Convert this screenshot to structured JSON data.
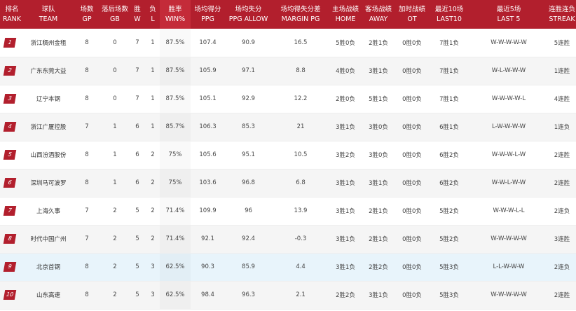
{
  "headers": [
    {
      "cn": "排名",
      "en": "RANK"
    },
    {
      "cn": "球队",
      "en": "TEAM"
    },
    {
      "cn": "场数",
      "en": "GP"
    },
    {
      "cn": "落后场数",
      "en": "GB"
    },
    {
      "cn": "胜",
      "en": "W"
    },
    {
      "cn": "负",
      "en": "L"
    },
    {
      "cn": "胜率",
      "en": "WIN%"
    },
    {
      "cn": "场均得分",
      "en": "PPG"
    },
    {
      "cn": "场均失分",
      "en": "PPG ALLOW"
    },
    {
      "cn": "场均得失分差",
      "en": "MARGIN PG"
    },
    {
      "cn": "主场战绩",
      "en": "HOME"
    },
    {
      "cn": "客场战绩",
      "en": "AWAY"
    },
    {
      "cn": "加时战绩",
      "en": "OT"
    },
    {
      "cn": "最近10场",
      "en": "LAST10"
    },
    {
      "cn": "最近5场",
      "en": "LAST 5"
    },
    {
      "cn": "连胜连负",
      "en": "STREAK"
    }
  ],
  "rows": [
    {
      "rank": "1",
      "team": "浙江稠州金租",
      "gp": "8",
      "gb": "0",
      "w": "7",
      "l": "1",
      "win_pct": "87.5%",
      "ppg": "107.4",
      "ppg_allow": "90.9",
      "margin": "16.5",
      "home": "5胜0负",
      "away": "2胜1负",
      "ot": "0胜0负",
      "last10": "7胜1负",
      "last5": "W-W-W-W-W",
      "streak": "5连胜"
    },
    {
      "rank": "2",
      "team": "广东东莞大益",
      "gp": "8",
      "gb": "0",
      "w": "7",
      "l": "1",
      "win_pct": "87.5%",
      "ppg": "105.9",
      "ppg_allow": "97.1",
      "margin": "8.8",
      "home": "4胜0负",
      "away": "3胜1负",
      "ot": "0胜0负",
      "last10": "7胜1负",
      "last5": "W-L-W-W-W",
      "streak": "1连胜"
    },
    {
      "rank": "3",
      "team": "辽宁本钢",
      "gp": "8",
      "gb": "0",
      "w": "7",
      "l": "1",
      "win_pct": "87.5%",
      "ppg": "105.1",
      "ppg_allow": "92.9",
      "margin": "12.2",
      "home": "2胜0负",
      "away": "5胜1负",
      "ot": "0胜0负",
      "last10": "7胜1负",
      "last5": "W-W-W-W-L",
      "streak": "4连胜"
    },
    {
      "rank": "4",
      "team": "浙江广厦控股",
      "gp": "7",
      "gb": "1",
      "w": "6",
      "l": "1",
      "win_pct": "85.7%",
      "ppg": "106.3",
      "ppg_allow": "85.3",
      "margin": "21",
      "home": "3胜1负",
      "away": "3胜0负",
      "ot": "0胜0负",
      "last10": "6胜1负",
      "last5": "L-W-W-W-W",
      "streak": "1连负"
    },
    {
      "rank": "5",
      "team": "山西汾酒股份",
      "gp": "8",
      "gb": "1",
      "w": "6",
      "l": "2",
      "win_pct": "75%",
      "ppg": "105.6",
      "ppg_allow": "95.1",
      "margin": "10.5",
      "home": "3胜2负",
      "away": "3胜0负",
      "ot": "0胜0负",
      "last10": "6胜2负",
      "last5": "W-W-W-L-W",
      "streak": "2连胜"
    },
    {
      "rank": "6",
      "team": "深圳马可波罗",
      "gp": "8",
      "gb": "1",
      "w": "6",
      "l": "2",
      "win_pct": "75%",
      "ppg": "103.6",
      "ppg_allow": "96.8",
      "margin": "6.8",
      "home": "3胜1负",
      "away": "3胜1负",
      "ot": "0胜0负",
      "last10": "6胜2负",
      "last5": "W-W-L-W-W",
      "streak": "2连胜"
    },
    {
      "rank": "7",
      "team": "上海久事",
      "gp": "7",
      "gb": "2",
      "w": "5",
      "l": "2",
      "win_pct": "71.4%",
      "ppg": "109.9",
      "ppg_allow": "96",
      "margin": "13.9",
      "home": "3胜1负",
      "away": "2胜1负",
      "ot": "0胜0负",
      "last10": "5胜2负",
      "last5": "W-W-W-L-L",
      "streak": "2连负"
    },
    {
      "rank": "8",
      "team": "时代中国广州",
      "gp": "7",
      "gb": "2",
      "w": "5",
      "l": "2",
      "win_pct": "71.4%",
      "ppg": "92.1",
      "ppg_allow": "92.4",
      "margin": "-0.3",
      "home": "3胜1负",
      "away": "2胜1负",
      "ot": "0胜0负",
      "last10": "5胜2负",
      "last5": "W-W-W-W-W",
      "streak": "3连胜"
    },
    {
      "rank": "9",
      "team": "北京首钢",
      "gp": "8",
      "gb": "2",
      "w": "5",
      "l": "3",
      "win_pct": "62.5%",
      "ppg": "90.3",
      "ppg_allow": "85.9",
      "margin": "4.4",
      "home": "3胜1负",
      "away": "2胜2负",
      "ot": "0胜0负",
      "last10": "5胜3负",
      "last5": "L-L-W-W-W",
      "streak": "2连负"
    },
    {
      "rank": "10",
      "team": "山东高速",
      "gp": "8",
      "gb": "2",
      "w": "5",
      "l": "3",
      "win_pct": "62.5%",
      "ppg": "98.4",
      "ppg_allow": "96.3",
      "margin": "2.1",
      "home": "2胜2负",
      "away": "3胜1负",
      "ot": "0胜0负",
      "last10": "5胜3负",
      "last5": "W-W-W-W-W",
      "streak": "2连胜"
    }
  ],
  "highlighted_row": 8,
  "colors": {
    "header_bg": "#b21f2d",
    "badge_bg": "#b21f2d",
    "row_alt": "#f5f5f5",
    "row_highlight": "#e8f4fb"
  }
}
